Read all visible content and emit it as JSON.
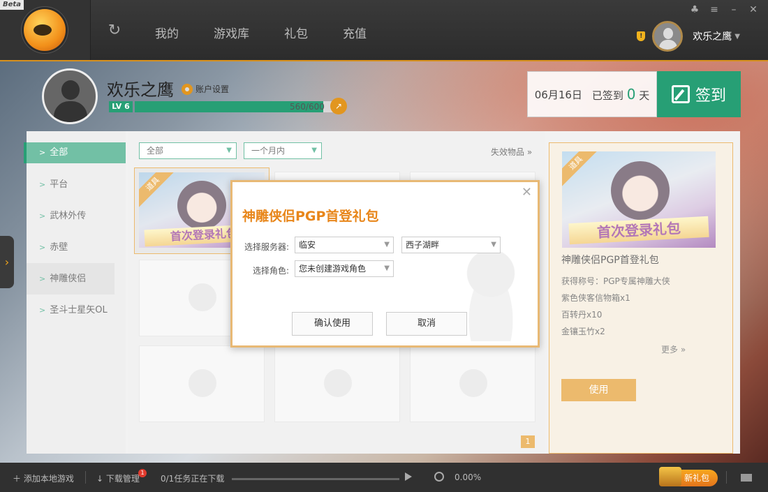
{
  "app": {
    "beta_label": "Beta"
  },
  "nav": {
    "items": [
      "我的",
      "游戏库",
      "礼包",
      "充值"
    ]
  },
  "user": {
    "name": "欢乐之鹰"
  },
  "profile": {
    "name": "欢乐之鹰",
    "account_settings": "账户设置",
    "level": "LV 6",
    "xp_text": "560/600",
    "xp_fraction": 0.93
  },
  "signin": {
    "date": "06月16日",
    "prefix": "已签到",
    "days": "0",
    "suffix": "天",
    "button": "签到"
  },
  "sidebar": {
    "items": [
      "全部",
      "平台",
      "武林外传",
      "赤壁",
      "神雕侠侣",
      "圣斗士星矢OL"
    ]
  },
  "filters": {
    "category": "全部",
    "period": "一个月内",
    "expired": "失效物品 »"
  },
  "gift_card": {
    "tag": "道具",
    "banner": "首次登录礼包"
  },
  "detail": {
    "tag": "道具",
    "banner": "首次登录礼包",
    "title": "神雕侠侣PGP首登礼包",
    "items": [
      "获得称号：PGP专属神雕大侠",
      "紫色侠客信物箱x1",
      "百转丹x10",
      "金镶玉竹x2"
    ],
    "more": "更多 »",
    "use_button": "使用"
  },
  "pagination": {
    "current": "1"
  },
  "dialog": {
    "title": "神雕侠侣PGP首登礼包",
    "server_label": "选择服务器:",
    "server_value": "临安",
    "zone_value": "西子湖畔",
    "role_label": "选择角色:",
    "role_value": "您未创建游戏角色",
    "confirm": "确认使用",
    "cancel": "取消"
  },
  "bottom": {
    "add_local": "添加本地游戏",
    "download_manager": "下载管理",
    "download_badge": "1",
    "task_status": "0/1任务正在下载",
    "percent": "0.00%",
    "new_gift": "新礼包"
  },
  "colors": {
    "accent_green": "#279f75",
    "accent_orange": "#e2961f",
    "dialog_title": "#e8861a"
  }
}
